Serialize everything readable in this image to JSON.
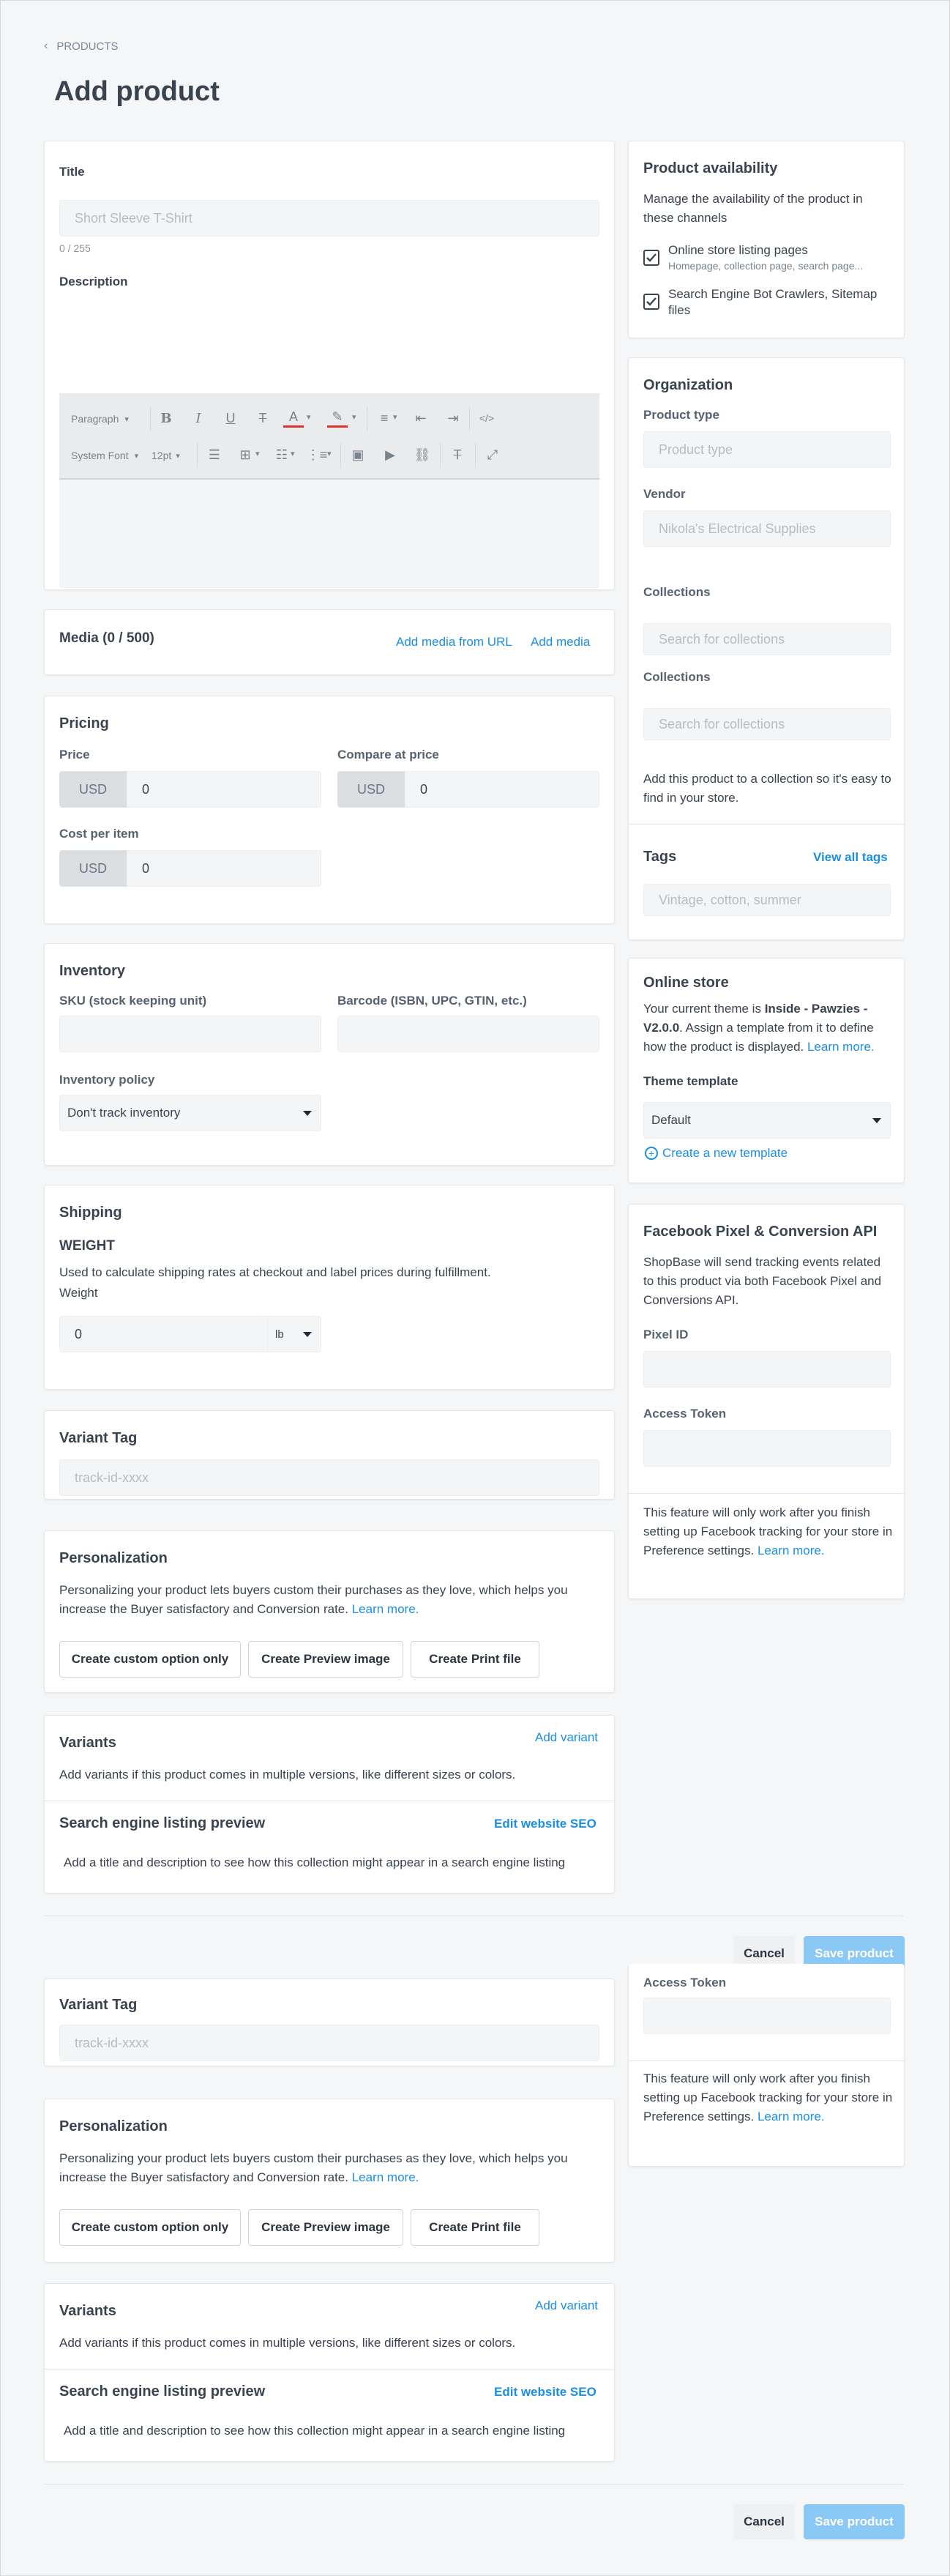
{
  "breadcrumb": "PRODUCTS",
  "page_title": "Add product",
  "title_card": {
    "title_label": "Title",
    "title_placeholder": "Short Sleeve T-Shirt",
    "counter": "0 / 255",
    "description_label": "Description",
    "toolbar": {
      "paragraph": "Paragraph",
      "font": "System Font",
      "size": "12pt"
    }
  },
  "media": {
    "title": "Media (0 / 500)",
    "add_from_url": "Add media from URL",
    "add_media": "Add media"
  },
  "pricing": {
    "title": "Pricing",
    "price_label": "Price",
    "compare_label": "Compare at price",
    "cost_label": "Cost per item",
    "currency": "USD",
    "price_value": "0",
    "compare_value": "0",
    "cost_value": "0"
  },
  "inventory": {
    "title": "Inventory",
    "sku_label": "SKU (stock keeping unit)",
    "barcode_label": "Barcode (ISBN, UPC, GTIN, etc.)",
    "policy_label": "Inventory policy",
    "policy_value": "Don't track inventory"
  },
  "shipping": {
    "title": "Shipping",
    "weight_heading": "WEIGHT",
    "description": "Used to calculate shipping rates at checkout and label prices during fulfillment.",
    "weight_label": "Weight",
    "weight_value": "0",
    "unit": "lb"
  },
  "variant_tag": {
    "title": "Variant Tag",
    "placeholder": "track-id-xxxx"
  },
  "personalization": {
    "title": "Personalization",
    "description": "Personalizing your product lets buyers custom their purchases as they love, which helps you increase the Buyer satisfactory and Conversion rate.",
    "learn_more": "Learn more.",
    "btn_custom": "Create custom option only",
    "btn_preview": "Create Preview image",
    "btn_print": "Create Print file"
  },
  "variants": {
    "title": "Variants",
    "add": "Add variant",
    "description": "Add variants if this product comes in multiple versions, like different sizes or colors."
  },
  "seo": {
    "title": "Search engine listing preview",
    "edit": "Edit website SEO",
    "description": "Add a title and description to see how this collection might appear in a search engine listing"
  },
  "availability": {
    "title": "Product availability",
    "description": "Manage the availability of the product in these channels",
    "online_store": "Online store listing pages",
    "online_store_sub": "Homepage, collection page, search page...",
    "search_bots": "Search Engine Bot Crawlers, Sitemap files"
  },
  "organization": {
    "title": "Organization",
    "type_label": "Product type",
    "type_placeholder": "Product type",
    "vendor_label": "Vendor",
    "vendor_placeholder": "Nikola's Electrical Supplies",
    "collections_label": "Collections",
    "collections_placeholder": "Search for collections",
    "collections_note": "Add this product to a collection so it's easy to find in your store.",
    "tags_label": "Tags",
    "view_tags": "View all tags",
    "tags_placeholder": "Vintage, cotton, summer"
  },
  "online_store": {
    "title": "Online store",
    "text_pre": "Your current theme is ",
    "theme_name": "Inside - Pawzies - V2.0.0",
    "text_post": ". Assign a template from it to define how the product is displayed. ",
    "learn_more": "Learn more.",
    "template_label": "Theme template",
    "template_value": "Default",
    "create_template": "Create a new template"
  },
  "facebook": {
    "title": "Facebook Pixel & Conversion API",
    "description": "ShopBase will send tracking events related to this product via both Facebook Pixel and Conversions API.",
    "pixel_label": "Pixel ID",
    "token_label": "Access Token",
    "note": "This feature will only work after you finish setting up Facebook tracking for your store in Preference settings.",
    "learn_more": "Learn more."
  },
  "actions": {
    "cancel": "Cancel",
    "save": "Save product"
  }
}
